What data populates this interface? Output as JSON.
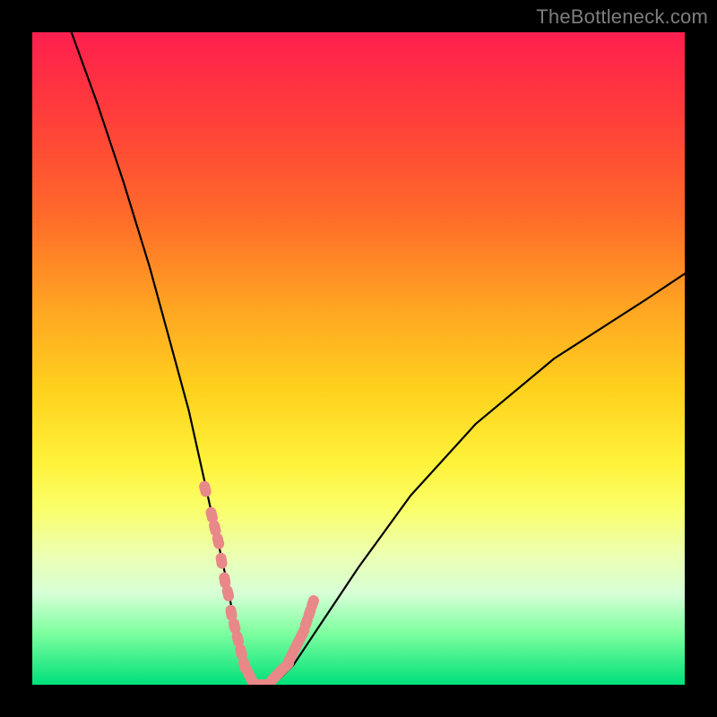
{
  "watermark": "TheBottleneck.com",
  "colors": {
    "background": "#000000",
    "gradient_top": "#ff1f4e",
    "gradient_bottom": "#00e07a",
    "curve": "#000000",
    "markers": "#e98888"
  },
  "chart_data": {
    "type": "line",
    "title": "",
    "xlabel": "",
    "ylabel": "",
    "xlim": [
      0,
      100
    ],
    "ylim": [
      0,
      100
    ],
    "grid": false,
    "curve": {
      "name": "bottleneck-curve",
      "x": [
        6,
        10,
        14,
        18,
        21,
        24,
        26,
        28,
        30,
        31,
        32,
        33,
        34,
        36,
        38,
        40,
        44,
        50,
        58,
        68,
        80,
        94,
        100
      ],
      "y": [
        100,
        89,
        77,
        64,
        53,
        42,
        33,
        24,
        15,
        9,
        5,
        2,
        0,
        0,
        1,
        3,
        9,
        18,
        29,
        40,
        50,
        59,
        63
      ]
    },
    "markers": {
      "name": "highlighted-points",
      "x": [
        26.5,
        27.5,
        28.0,
        28.5,
        29.0,
        29.5,
        30.0,
        30.5,
        31.0,
        31.5,
        32.0,
        32.5,
        33.0,
        33.5,
        34.0,
        34.5,
        35.0,
        36.0,
        37.0,
        37.5,
        38.0,
        38.5,
        39.0,
        39.5,
        40.0,
        40.5,
        41.0,
        41.5,
        42.0,
        42.5,
        43.0
      ],
      "y": [
        30,
        26,
        24,
        22,
        19,
        16,
        14,
        11,
        9,
        7,
        5,
        3,
        2,
        1,
        0,
        0,
        0,
        0,
        1,
        1.5,
        2,
        2.5,
        3,
        4,
        5,
        6,
        7,
        8,
        9.5,
        11,
        12.5
      ],
      "shape": "rounded-dash",
      "color": "#e98888"
    }
  }
}
